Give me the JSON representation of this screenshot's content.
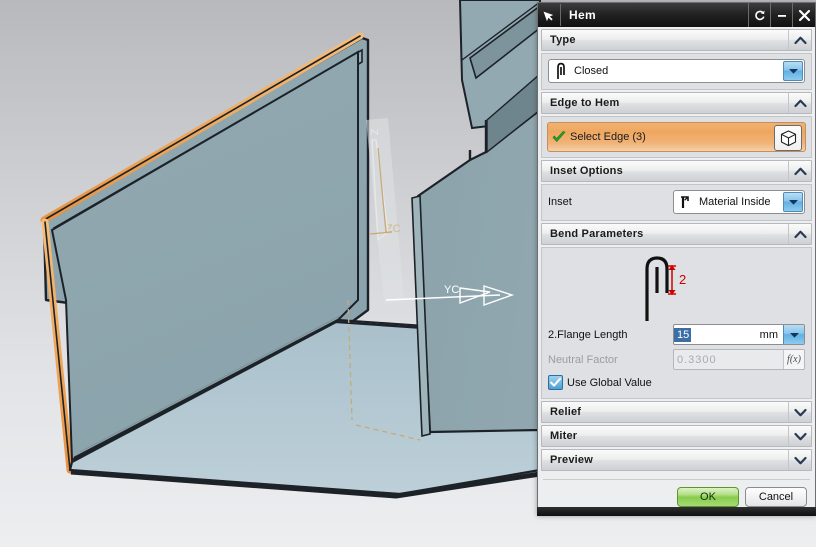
{
  "dialog": {
    "title": "Hem",
    "title_icon": "arrow-cursor-icon",
    "titlebar_buttons": [
      {
        "name": "reset-button",
        "glyph": "↺"
      },
      {
        "name": "minimize-button",
        "glyph": "–"
      },
      {
        "name": "close-button",
        "glyph": "✕"
      }
    ]
  },
  "sections": {
    "type": {
      "header": "Type",
      "state": "expanded",
      "value": "Closed",
      "icon": "closed-hem-profile-icon"
    },
    "edge_to_hem": {
      "header": "Edge to Hem",
      "state": "expanded",
      "select_label": "Select Edge (3)",
      "check_icon": "green-check-icon",
      "cube_icon": "select-body-cube-icon"
    },
    "inset_options": {
      "header": "Inset Options",
      "state": "expanded",
      "inset_label": "Inset",
      "inset_value": "Material Inside",
      "inset_icon": "material-inside-icon"
    },
    "bend_parameters": {
      "header": "Bend Parameters",
      "state": "expanded",
      "graphic": {
        "name": "hem-profile-diagram",
        "dimension_label": "2",
        "dimension_color": "#cc0000"
      },
      "flange_length_label": "2.Flange Length",
      "flange_length_value": "15",
      "flange_length_unit": "mm",
      "neutral_factor_label": "Neutral Factor",
      "neutral_factor_value": "0.3300",
      "neutral_factor_fx": "f(x)",
      "use_global_label": "Use Global Value",
      "use_global_checked": true
    },
    "relief": {
      "header": "Relief",
      "state": "collapsed"
    },
    "miter": {
      "header": "Miter",
      "state": "collapsed"
    },
    "preview": {
      "header": "Preview",
      "state": "collapsed"
    }
  },
  "footer": {
    "ok_label": "OK",
    "cancel_label": "Cancel"
  },
  "viewport": {
    "axis_labels": {
      "zc": "ZC",
      "yc": "YC",
      "z_small": "Z"
    },
    "colors": {
      "background_top": "#b9babd",
      "background_bottom": "#eceef0",
      "sheet_face": "#8fa6ae",
      "sheet_face_light": "#b5c8d2",
      "sheet_face_dark": "#7d949d",
      "highlight_edge": "#f0a24a",
      "outline": "#1c2228",
      "annotation": "#ffffff"
    }
  }
}
